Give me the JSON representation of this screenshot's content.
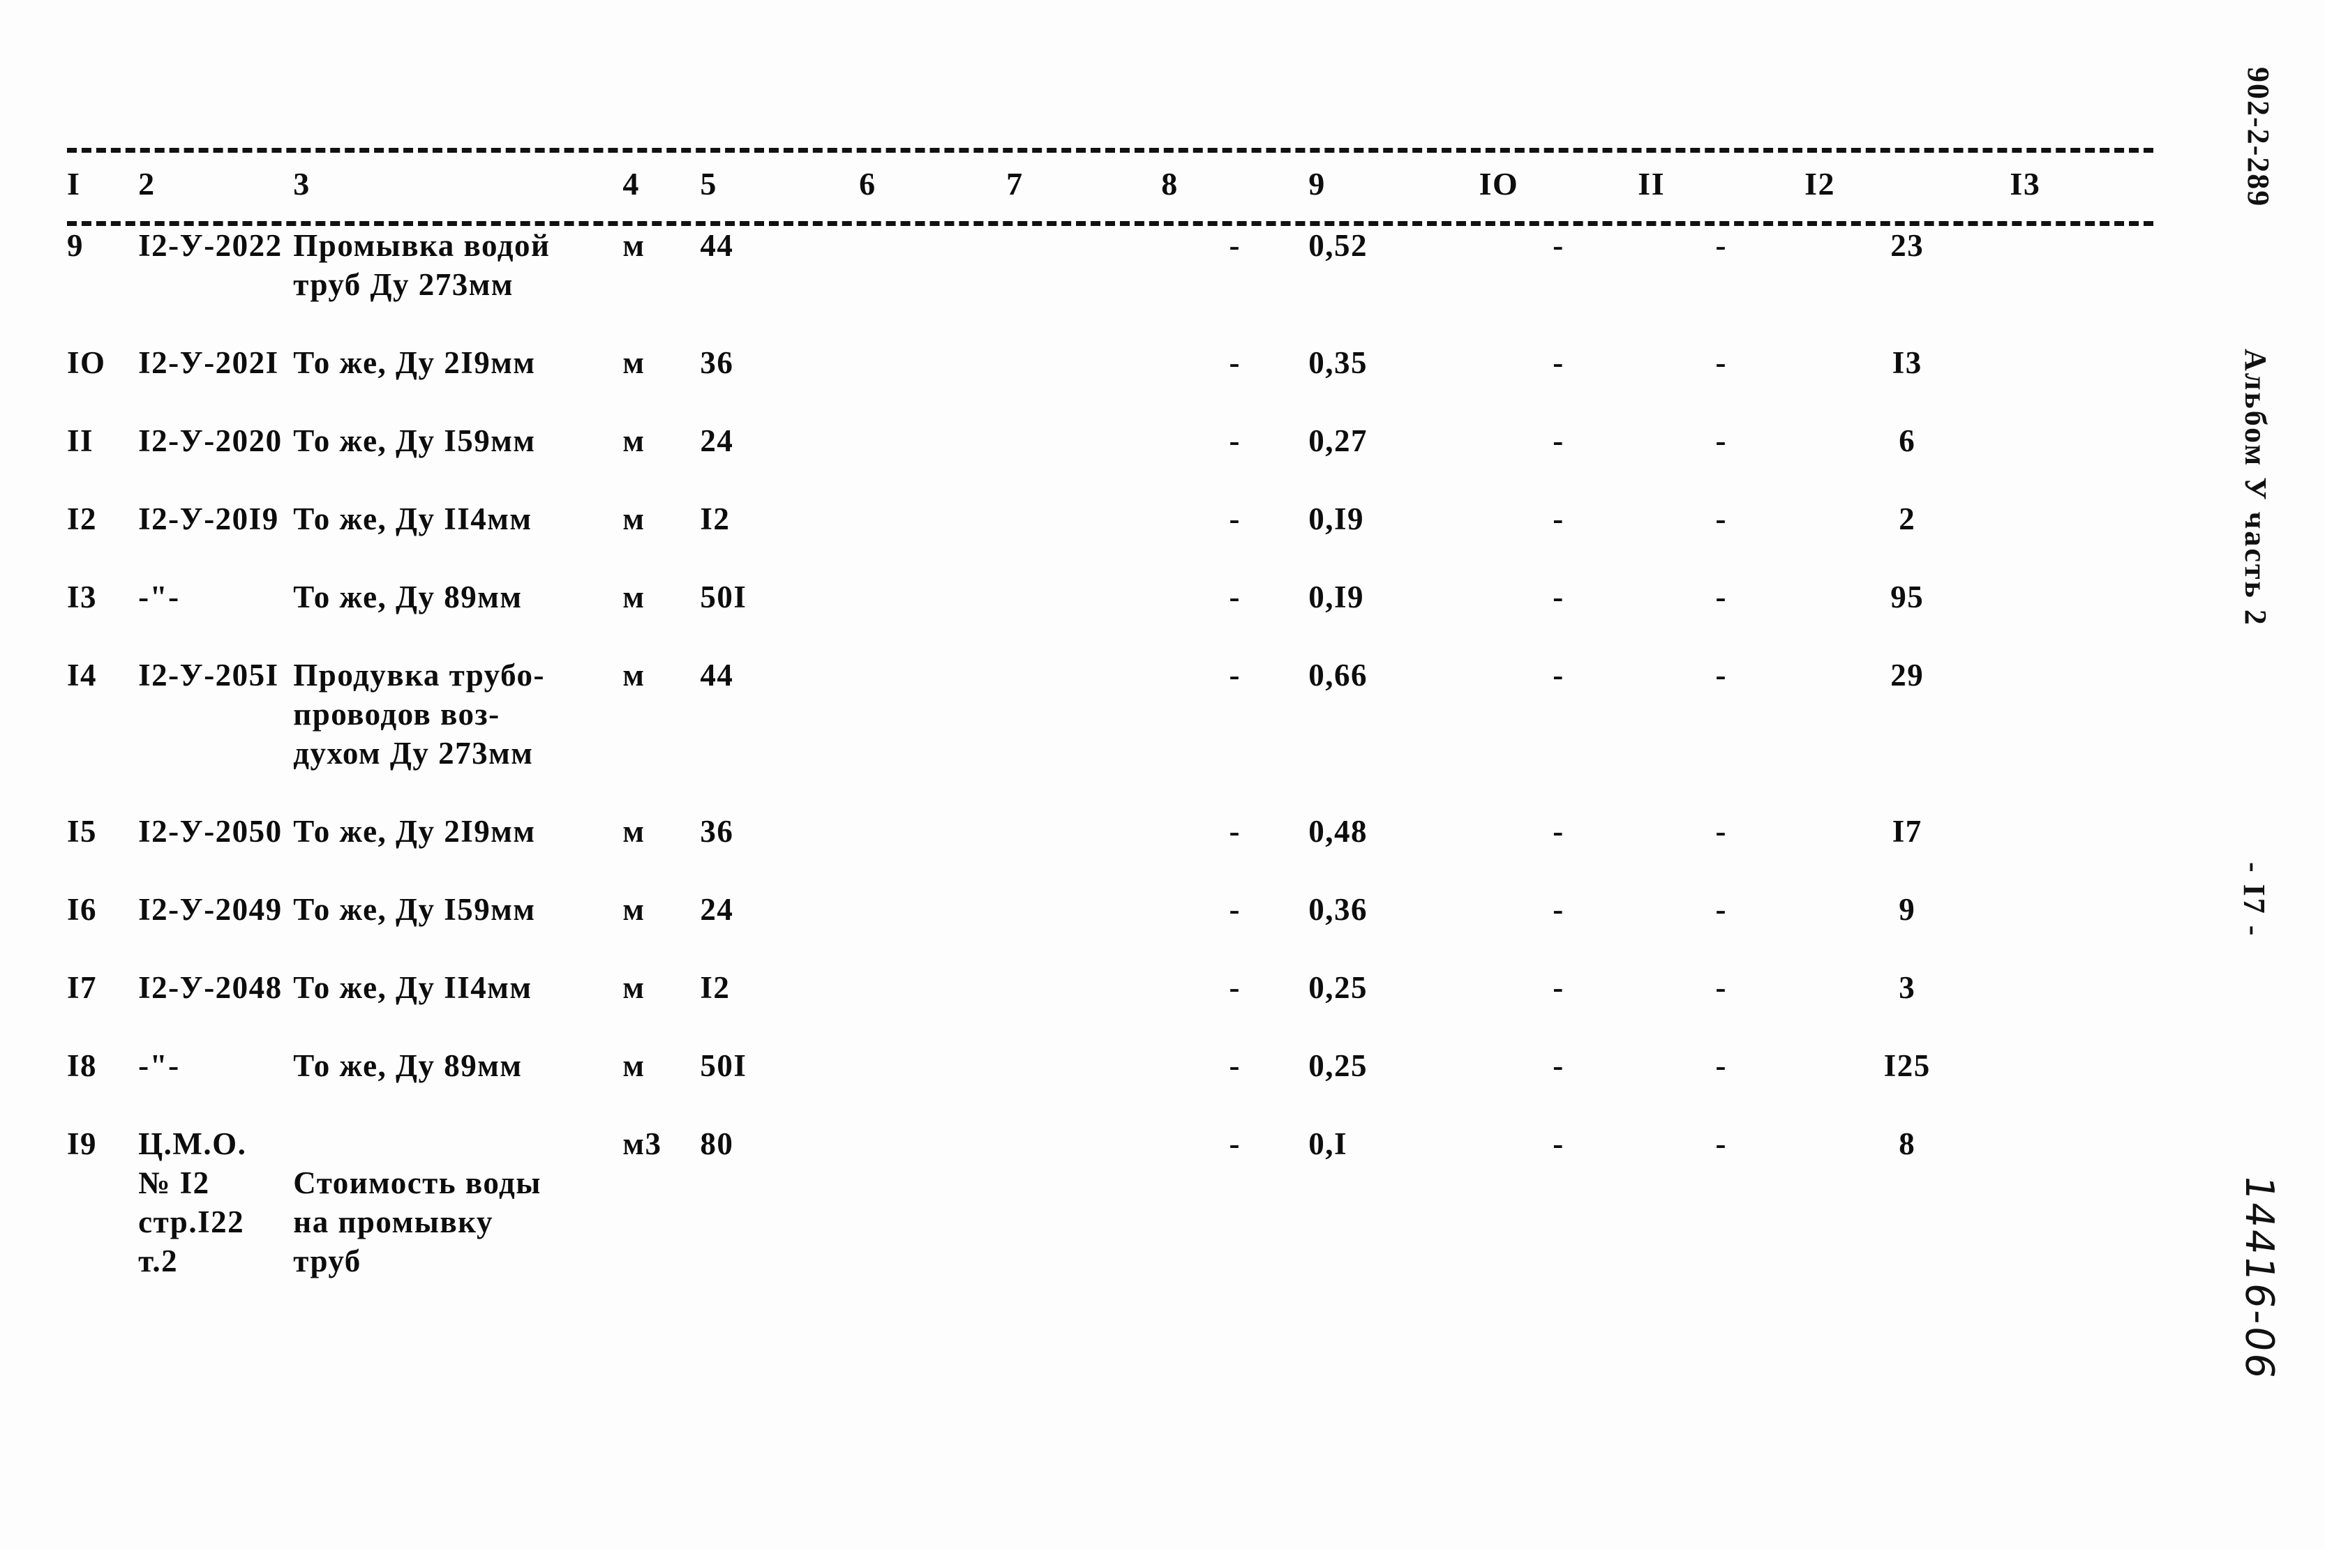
{
  "document": {
    "doc_code": "902-2-289",
    "album_label": "Альбом У часть 2",
    "page_number": "- I7 -",
    "archive_stamp": "14416-06"
  },
  "table": {
    "column_headers": [
      "I",
      "2",
      "3",
      "4",
      "5",
      "6",
      "7",
      "8",
      "9",
      "IO",
      "II",
      "I2",
      "I3"
    ],
    "rows": [
      {
        "c1": "9",
        "c2": "I2-У-2022",
        "c3": "Промывка водой\nтруб Ду 273мм",
        "c4": "м",
        "c5": "44",
        "c6": "",
        "c7": "",
        "c8": "-",
        "c9": "0,52",
        "c10": "-",
        "c11": "-",
        "c12": "23",
        "c13": ""
      },
      {
        "c1": "IO",
        "c2": "I2-У-202I",
        "c3": "То же, Ду 2I9мм",
        "c4": "м",
        "c5": "36",
        "c6": "",
        "c7": "",
        "c8": "-",
        "c9": "0,35",
        "c10": "-",
        "c11": "-",
        "c12": "I3",
        "c13": ""
      },
      {
        "c1": "II",
        "c2": "I2-У-2020",
        "c3": "То же, Ду I59мм",
        "c4": "м",
        "c5": "24",
        "c6": "",
        "c7": "",
        "c8": "-",
        "c9": "0,27",
        "c10": "-",
        "c11": "-",
        "c12": "6",
        "c13": ""
      },
      {
        "c1": "I2",
        "c2": "I2-У-20I9",
        "c3": "То же, Ду II4мм",
        "c4": "м",
        "c5": "I2",
        "c6": "",
        "c7": "",
        "c8": "-",
        "c9": "0,I9",
        "c10": "-",
        "c11": "-",
        "c12": "2",
        "c13": ""
      },
      {
        "c1": "I3",
        "c2": "-\"-",
        "c3": "То же, Ду 89мм",
        "c4": "м",
        "c5": "50I",
        "c6": "",
        "c7": "",
        "c8": "-",
        "c9": "0,I9",
        "c10": "-",
        "c11": "-",
        "c12": "95",
        "c13": ""
      },
      {
        "c1": "I4",
        "c2": "I2-У-205I",
        "c3": "Продувка трубо-\nпроводов воз-\nдухом Ду 273мм",
        "c4": "м",
        "c5": "44",
        "c6": "",
        "c7": "",
        "c8": "-",
        "c9": "0,66",
        "c10": "-",
        "c11": "-",
        "c12": "29",
        "c13": ""
      },
      {
        "c1": "I5",
        "c2": "I2-У-2050",
        "c3": "То же, Ду 2I9мм",
        "c4": "м",
        "c5": "36",
        "c6": "",
        "c7": "",
        "c8": "-",
        "c9": "0,48",
        "c10": "-",
        "c11": "-",
        "c12": "I7",
        "c13": ""
      },
      {
        "c1": "I6",
        "c2": "I2-У-2049",
        "c3": "То же, Ду I59мм",
        "c4": "м",
        "c5": "24",
        "c6": "",
        "c7": "",
        "c8": "-",
        "c9": "0,36",
        "c10": "-",
        "c11": "-",
        "c12": "9",
        "c13": ""
      },
      {
        "c1": "I7",
        "c2": "I2-У-2048",
        "c3": "То же, Ду II4мм",
        "c4": "м",
        "c5": "I2",
        "c6": "",
        "c7": "",
        "c8": "-",
        "c9": "0,25",
        "c10": "-",
        "c11": "-",
        "c12": "3",
        "c13": ""
      },
      {
        "c1": "I8",
        "c2": "-\"-",
        "c3": "То же, Ду 89мм",
        "c4": "м",
        "c5": "50I",
        "c6": "",
        "c7": "",
        "c8": "-",
        "c9": "0,25",
        "c10": "-",
        "c11": "-",
        "c12": "I25",
        "c13": ""
      },
      {
        "c1": "I9",
        "c2": "Ц.М.О.\n№ I2\nстр.I22\nт.2",
        "c3": "\nСтоимость воды\nна промывку\n труб",
        "c4": "м3",
        "c5": "80",
        "c6": "",
        "c7": "",
        "c8": "-",
        "c9": "0,I",
        "c10": "-",
        "c11": "-",
        "c12": "8",
        "c13": ""
      }
    ]
  }
}
